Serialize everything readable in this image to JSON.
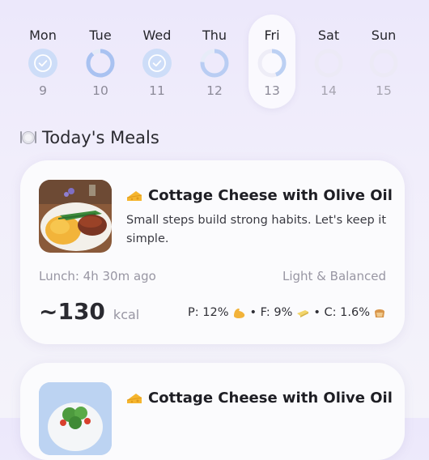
{
  "week": [
    {
      "name": "Mon",
      "num": "9",
      "status": "done"
    },
    {
      "name": "Tue",
      "num": "10",
      "status": "high"
    },
    {
      "name": "Wed",
      "num": "11",
      "status": "done"
    },
    {
      "name": "Thu",
      "num": "12",
      "status": "mid"
    },
    {
      "name": "Fri",
      "num": "13",
      "status": "low",
      "selected": true
    },
    {
      "name": "Sat",
      "num": "14",
      "status": "future"
    },
    {
      "name": "Sun",
      "num": "15",
      "status": "future"
    }
  ],
  "section": {
    "icon": "plate-icon",
    "title": "Today's Meals"
  },
  "meals": [
    {
      "icon": "cheese-icon",
      "title": "Cottage Cheese with Olive Oil",
      "description": "Small steps build strong habits. Let's keep it simple.",
      "time": "Lunch: 4h 30m ago",
      "tag": "Light & Balanced",
      "kcal": "~130",
      "kcal_unit": "kcal",
      "protein": "P: 12%",
      "fat": "• F: 9%",
      "carbs": "• C: 1.6%"
    },
    {
      "icon": "cheese-icon",
      "title": "Cottage Cheese with Olive Oil"
    }
  ],
  "colors": {
    "accent": "#8fb0ef",
    "ring_empty": "#ecebf6"
  }
}
